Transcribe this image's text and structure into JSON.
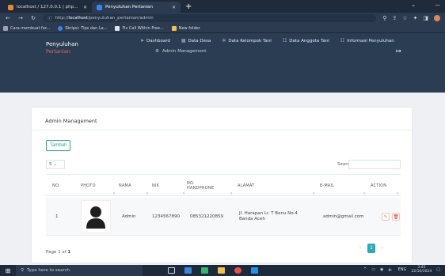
{
  "browser": {
    "tabs": [
      {
        "title": "localhost / 127.0.0.1 | phpMyA",
        "fav_color": "#e58a2e",
        "active": false
      },
      {
        "title": "Penyuluhan Pertanian",
        "fav_color": "#3b82f6",
        "active": true
      }
    ],
    "new_tab": "+",
    "win_controls": [
      "⌄",
      "—"
    ],
    "url_prefix": "http://",
    "url_host": "localhost",
    "url_path": "/penyuluhan_pertanian/admin",
    "bookmarks": [
      {
        "label": "Cara membuat for...",
        "color": "#9aa3ae"
      },
      {
        "label": "Skripsi: Tips dan La...",
        "color": "#3b82f6"
      },
      {
        "label": "Fix Call Within Free...",
        "color": "#e0e4ea"
      },
      {
        "label": "New folder",
        "color": "#f2c14e"
      }
    ]
  },
  "header": {
    "brand_line1": "Penyuluhan",
    "brand_line2": "Pertanian",
    "nav": [
      {
        "icon": "send-icon",
        "glyph": "➤",
        "label": "Dashboard"
      },
      {
        "icon": "table-icon",
        "glyph": "▦",
        "label": "Data Desa"
      },
      {
        "icon": "gear-icon",
        "glyph": "✲",
        "label": "Data Kelompok Tani"
      },
      {
        "icon": "users-icon",
        "glyph": "☷",
        "label": "Data Anggota Tani"
      },
      {
        "icon": "users-icon",
        "glyph": "☷",
        "label": "Informasi Penyuluhan"
      }
    ],
    "subnav_icon": "⚙",
    "subnav_label": "Admin Management",
    "logout_glyph": "↦"
  },
  "admin": {
    "title": "Admin Management",
    "add_button": "Tambah",
    "page_length": "5",
    "search_label": "Search:",
    "columns": [
      "NO.",
      "PHOTO",
      "NAMA",
      "NIK",
      "NO. HANDPHONE",
      "ALAMAT",
      "E-MAIL",
      "ACTION"
    ],
    "rows": [
      {
        "no": "1",
        "nama": "Admin",
        "nik": "1234567890",
        "hp": "085321220859",
        "alamat": "Jl. Harapan Lr. T Benu No.4 Banda Aceh",
        "email": "admin@gmail.com"
      }
    ],
    "page_info_prefix": "Page 1 of ",
    "page_info_total": "1",
    "pager": {
      "prev": "‹",
      "current": "1",
      "next": "›"
    }
  },
  "taskbar": {
    "search_placeholder": "Type here to search",
    "time": "3:45",
    "date": "22/10/2024",
    "lang": "ENG"
  },
  "colors": {
    "header_bg": "#2b3d52",
    "accent": "#2ea88c",
    "brand_accent": "#e06a5b"
  }
}
